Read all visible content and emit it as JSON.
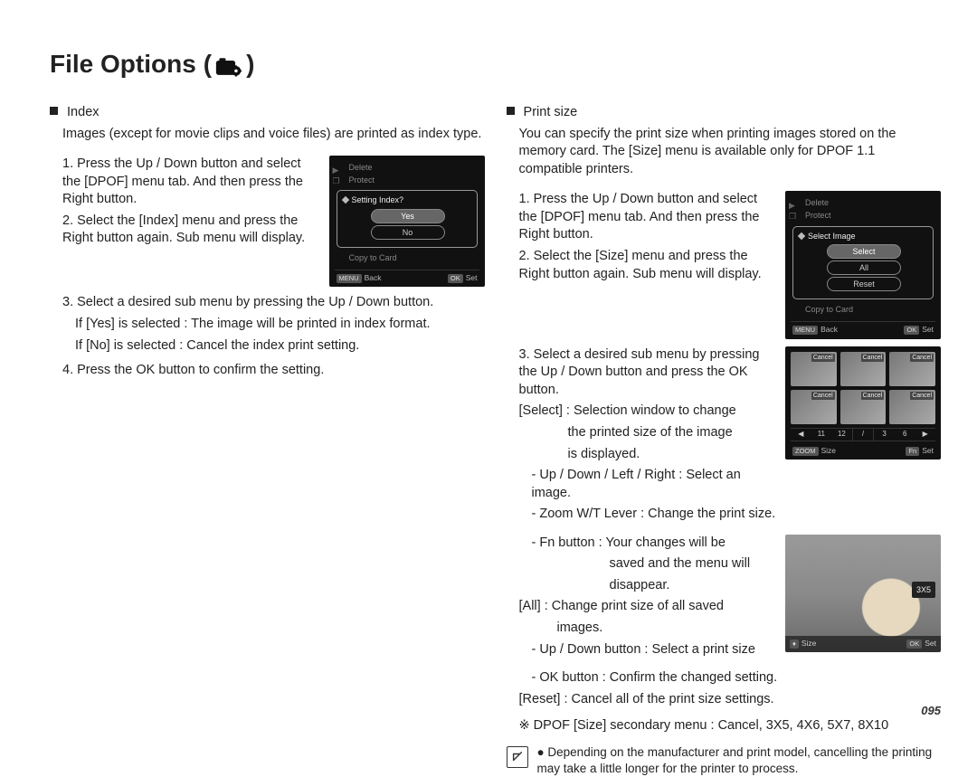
{
  "title": "File Options",
  "page_number": "095",
  "left": {
    "heading": "Index",
    "intro": "Images (except for movie clips and voice files) are printed as index type.",
    "steps": {
      "s1": "1. Press the Up / Down button and select the [DPOF] menu tab. And then press the Right button.",
      "s2": "2. Select the [Index] menu and press the Right button again. Sub menu will display.",
      "s3": "3. Select a desired sub menu by pressing the Up / Down button.",
      "s3a": "If [Yes] is selected : The image will be printed in index format.",
      "s3b": "If [No] is selected   : Cancel the index print setting.",
      "s4": "4. Press the OK button to confirm the setting."
    },
    "shot": {
      "m1": "Delete",
      "m2": "Protect",
      "panel_title": "Setting Index?",
      "opt_yes": "Yes",
      "opt_no": "No",
      "m3": "Copy to Card",
      "back_kbd": "MENU",
      "back": "Back",
      "set_kbd": "OK",
      "set": "Set"
    }
  },
  "right": {
    "heading": "Print size",
    "intro": "You can specify the print size when printing images stored on the memory card. The [Size] menu is available only for DPOF 1.1 compatible printers.",
    "steps": {
      "s1": "1. Press the Up / Down button and select the [DPOF] menu tab. And then press the Right button.",
      "s2": "2. Select the [Size] menu and press the Right button again. Sub menu will display.",
      "s3": "3. Select a desired sub menu by pressing the Up / Down button and press the OK button.",
      "sel_head": "[Select] : Selection window to change",
      "sel_l1": "the printed size of the image",
      "sel_l2": "is displayed.",
      "sel_b1": "- Up / Down / Left / Right : Select an image.",
      "sel_b2": "- Zoom W/T Lever : Change the print size.",
      "sel_b3": "- Fn button : Your changes will be",
      "sel_b3a": "saved and the menu will",
      "sel_b3b": "disappear.",
      "all_head": "[All] : Change print size of all saved",
      "all_l1": "images.",
      "all_b1": "- Up / Down button : Select a print size",
      "all_b2": "- OK button : Confirm the changed setting.",
      "reset": "[Reset] : Cancel all of the print size settings."
    },
    "dpof_note": "※ DPOF [Size] secondary menu : Cancel, 3X5, 4X6, 5X7, 8X10",
    "note_bullet": "Depending on the manufacturer and print model, cancelling the printing may take a little longer for the printer to process.",
    "shot1": {
      "m1": "Delete",
      "m2": "Protect",
      "panel_title": "Select Image",
      "opt_select": "Select",
      "opt_all": "All",
      "opt_reset": "Reset",
      "m3": "Copy to Card",
      "back_kbd": "MENU",
      "back": "Back",
      "set_kbd": "OK",
      "set": "Set"
    },
    "shot2": {
      "n1": "11",
      "n2": "12",
      "mid": "/",
      "n3": "3",
      "n4": "6",
      "size_kbd": "ZOOM",
      "size": "Size",
      "set_kbd": "Fn",
      "set": "Set"
    },
    "shot3": {
      "badge": "3X5",
      "size_kbd": "♦",
      "size": "Size",
      "set_kbd": "OK",
      "set": "Set"
    }
  }
}
